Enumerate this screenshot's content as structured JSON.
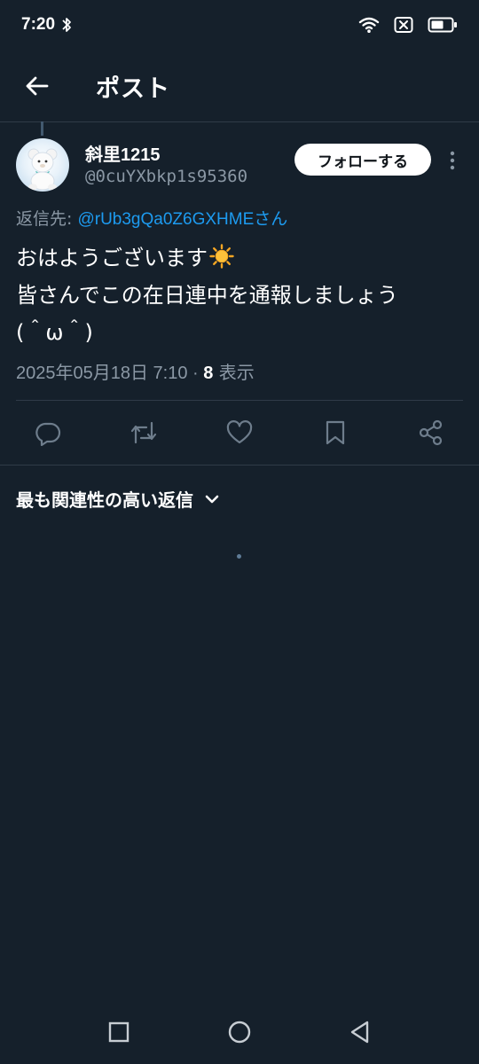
{
  "status_bar": {
    "time": "7:20",
    "icons": [
      "bluetooth-icon",
      "wifi-icon",
      "sim-off-icon",
      "battery-icon"
    ]
  },
  "header": {
    "back_icon": "arrow-left-icon",
    "title": "ポスト"
  },
  "post": {
    "author_name": "斜里1215",
    "author_handle": "@0cuYXbkp1s95360",
    "follow_label": "フォローする",
    "more_icon": "vertical-dots-icon",
    "reply_prefix": "返信先: ",
    "reply_to": "@rUb3gQa0Z6GXHMEさん",
    "text_lines": [
      "おはようございます",
      "皆さんでこの在日連中を通報しましょう",
      "(＾ω＾)"
    ],
    "emoji_icon": "sun-icon",
    "date": "2025年05月18日 7:10 · ",
    "view_count": "8",
    "view_label": " 表示"
  },
  "actions": [
    "reply-icon",
    "repost-icon",
    "like-icon",
    "bookmark-icon",
    "share-icon"
  ],
  "replies": {
    "sort_label": "最も関連性の高い返信",
    "sort_icon": "chevron-down-icon"
  },
  "colors": {
    "background": "#15202b",
    "link": "#1d9bf0",
    "secondary_text": "#8b98a5",
    "divider": "#2f3b48"
  },
  "nav_bar": [
    "square-icon",
    "circle-icon",
    "triangle-back-icon"
  ]
}
